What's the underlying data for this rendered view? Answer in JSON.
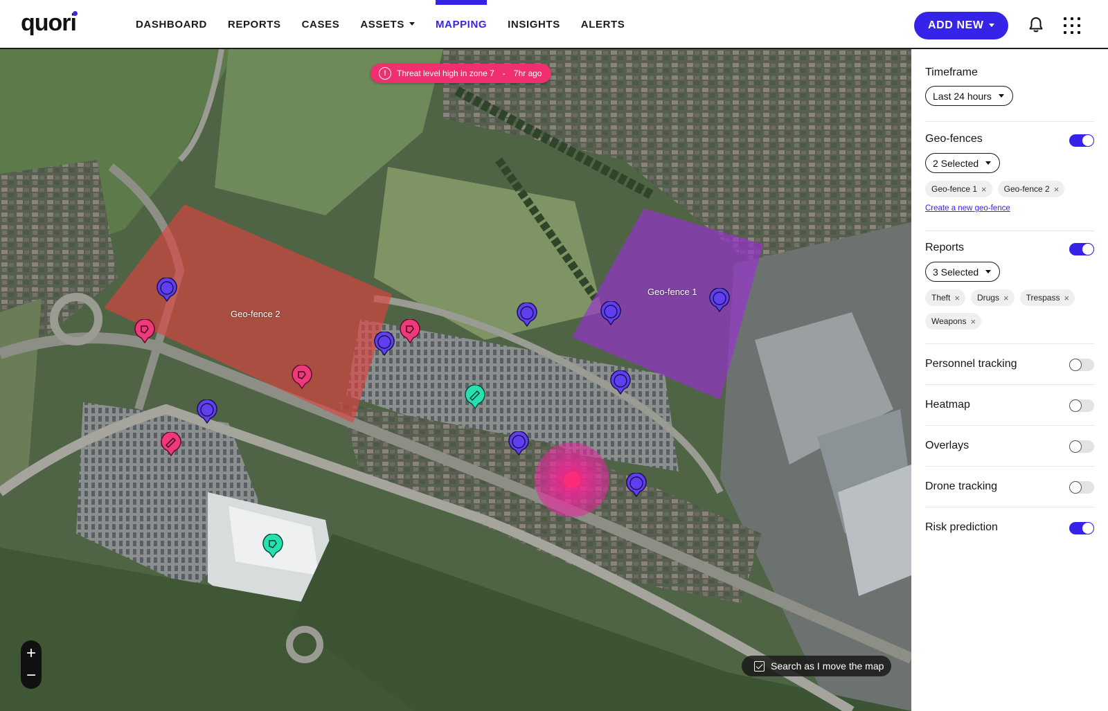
{
  "brand": {
    "logo": "quori"
  },
  "nav": {
    "items": [
      {
        "label": "DASHBOARD",
        "active": false
      },
      {
        "label": "REPORTS",
        "active": false
      },
      {
        "label": "CASES",
        "active": false
      },
      {
        "label": "ASSETS",
        "active": false,
        "has_dropdown": true
      },
      {
        "label": "MAPPING",
        "active": true
      },
      {
        "label": "INSIGHTS",
        "active": false
      },
      {
        "label": "ALERTS",
        "active": false
      }
    ],
    "add_new_label": "ADD NEW",
    "bell_icon": "bell-icon",
    "apps_icon": "apps-grid-icon"
  },
  "map": {
    "alert": {
      "text": "Threat level high in zone 7",
      "separator": "-",
      "time": "7hr ago"
    },
    "fence_labels": [
      "Geo-fence 2",
      "Geo-fence 1"
    ],
    "search_as_move": {
      "label": "Search as I move the map",
      "checked": true
    },
    "zoom": {
      "in": "+",
      "out": "−"
    },
    "colors": {
      "fence2": "#e0413f",
      "fence1": "#9b2fd6",
      "personnel_pin": "#5f3ff0",
      "report_pin": "#f0397a",
      "drone_pin": "#26e0b0",
      "heat": "#ef1f8f"
    }
  },
  "panel": {
    "timeframe": {
      "title": "Timeframe",
      "value": "Last 24 hours"
    },
    "geofences": {
      "title": "Geo-fences",
      "enabled": true,
      "dropdown": "2 Selected",
      "chips": [
        "Geo-fence 1",
        "Geo-fence 2"
      ],
      "create_link": "Create a new geo-fence"
    },
    "reports": {
      "title": "Reports",
      "enabled": true,
      "dropdown": "3 Selected",
      "chips": [
        "Theft",
        "Drugs",
        "Trespass",
        "Weapons"
      ]
    },
    "toggles": [
      {
        "label": "Personnel tracking",
        "enabled": false
      },
      {
        "label": "Heatmap",
        "enabled": false
      },
      {
        "label": "Overlays",
        "enabled": false
      },
      {
        "label": "Drone tracking",
        "enabled": false
      },
      {
        "label": "Risk prediction",
        "enabled": true
      }
    ]
  }
}
